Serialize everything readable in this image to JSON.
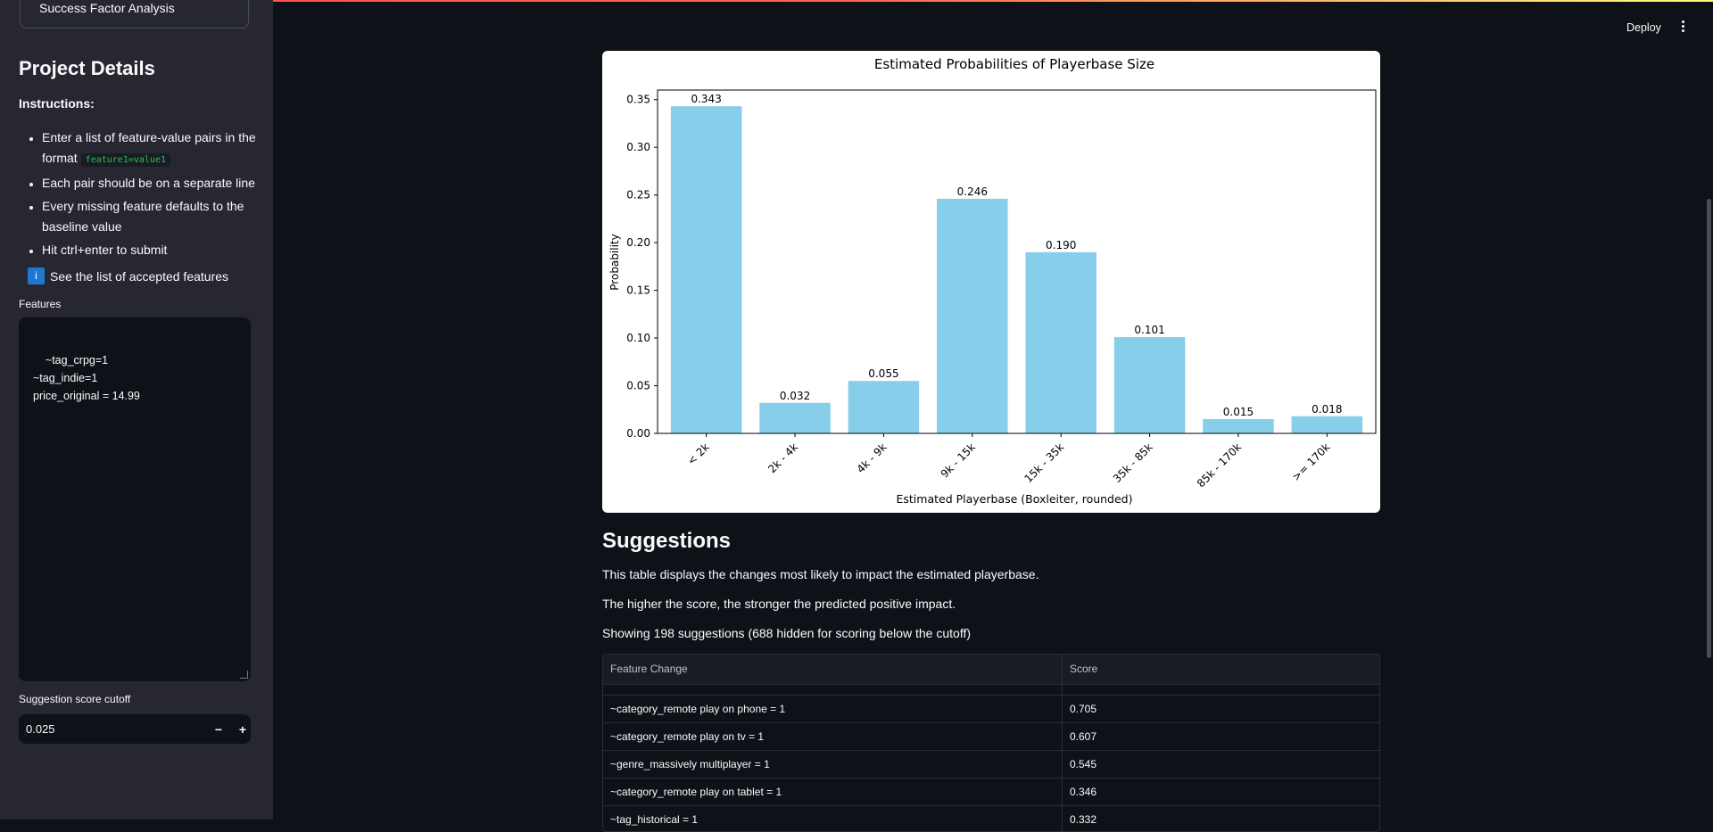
{
  "sidebar": {
    "nav_item": "Success Factor Analysis",
    "title": "Project Details",
    "instructions_label": "Instructions:",
    "instructions": [
      "Enter a list of feature-value pairs in the format",
      "Each pair should be on a separate line",
      "Every missing feature defaults to the baseline value",
      "Hit ctrl+enter to submit"
    ],
    "format_code": "feature1=value1",
    "accepted_features_link": "See the list of accepted features",
    "info_icon_glyph": "i",
    "features_label": "Features",
    "features_value": "~tag_crpg=1\n~tag_indie=1\nprice_original = 14.99",
    "cutoff_label": "Suggestion score cutoff",
    "cutoff_value": "0.025",
    "minus_label": "−",
    "plus_label": "+"
  },
  "header": {
    "deploy_label": "Deploy"
  },
  "chart_data": {
    "type": "bar",
    "title": "Estimated Probabilities of Playerbase Size",
    "xlabel": "Estimated Playerbase (Boxleiter, rounded)",
    "ylabel": "Probability",
    "categories": [
      "< 2k",
      "2k - 4k",
      "4k - 9k",
      "9k - 15k",
      "15k - 35k",
      "35k - 85k",
      "85k - 170k",
      ">= 170k"
    ],
    "values": [
      0.343,
      0.032,
      0.055,
      0.246,
      0.19,
      0.101,
      0.015,
      0.018
    ],
    "data_labels": [
      "0.343",
      "0.032",
      "0.055",
      "0.246",
      "0.190",
      "0.101",
      "0.015",
      "0.018"
    ],
    "yticks": [
      "0.00",
      "0.05",
      "0.10",
      "0.15",
      "0.20",
      "0.25",
      "0.30",
      "0.35"
    ],
    "ylim": [
      0,
      0.36
    ],
    "bar_color": "#87ceeb",
    "grid": false,
    "legend": "none"
  },
  "main": {
    "suggestions_title": "Suggestions",
    "para1": "This table displays the changes most likely to impact the estimated playerbase.",
    "para2": "The higher the score, the stronger the predicted positive impact.",
    "para3": "Showing 198 suggestions (688 hidden for scoring below the cutoff)",
    "table": {
      "headers": [
        "Feature Change",
        "Score"
      ],
      "rows": [
        [
          "~category_remote play on phone = 1",
          "0.705"
        ],
        [
          "~category_remote play on tv = 1",
          "0.607"
        ],
        [
          "~genre_massively multiplayer = 1",
          "0.545"
        ],
        [
          "~category_remote play on tablet = 1",
          "0.346"
        ],
        [
          "~tag_historical = 1",
          "0.332"
        ]
      ]
    }
  }
}
